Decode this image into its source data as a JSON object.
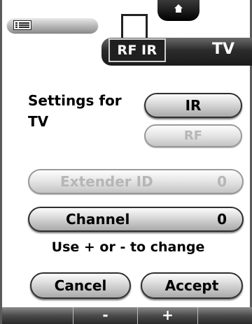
{
  "header": {
    "rf_label": "RF",
    "ir_label": "IR",
    "device_title": "TV"
  },
  "settings": {
    "label_line1": "Settings for",
    "label_line2": "TV"
  },
  "mode_buttons": {
    "ir": "IR",
    "rf": "RF"
  },
  "extender": {
    "label": "Extender ID",
    "value": "0"
  },
  "channel": {
    "label": "Channel",
    "value": "0"
  },
  "hint": "Use + or - to change",
  "actions": {
    "cancel": "Cancel",
    "accept": "Accept"
  },
  "bottom_bar": {
    "minus": "-",
    "plus": "+"
  },
  "icons": [
    "home-icon",
    "menu-list-icon",
    "device-icon"
  ],
  "colors": {
    "title_bar": "#1b1b1b",
    "disabled_text": "#b6b6b6",
    "button_face": "#d7d7d7"
  }
}
